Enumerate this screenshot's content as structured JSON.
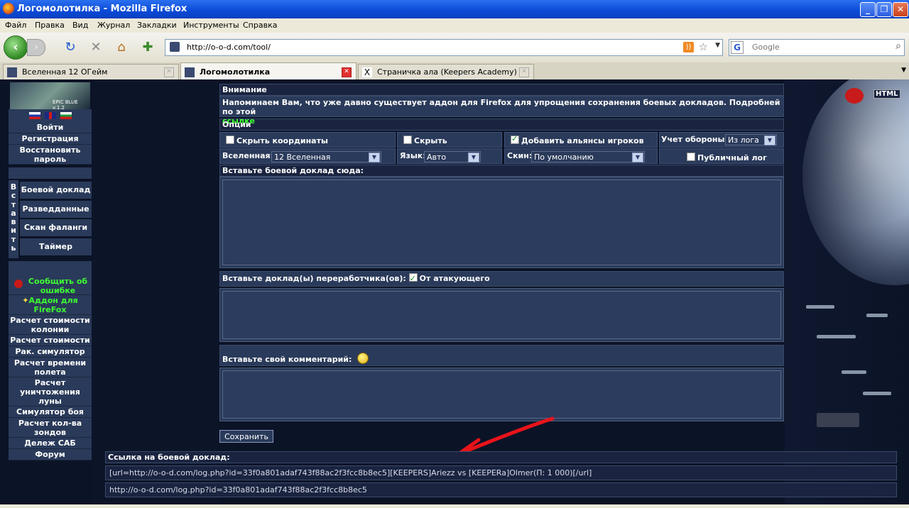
{
  "window": {
    "title": "Логомолотилка - Mozilla Firefox"
  },
  "menu": [
    "Файл",
    "Правка",
    "Вид",
    "Журнал",
    "Закладки",
    "Инструменты",
    "Справка"
  ],
  "nav": {
    "url": "http://o-o-d.com/tool/",
    "search_placeholder": "Google"
  },
  "tabs": [
    {
      "label": "Вселенная 12 ОГейм",
      "active": false
    },
    {
      "label": "Логомолотилка",
      "active": true
    },
    {
      "label": "Страничка ала (Keepers Academy)",
      "active": false
    }
  ],
  "sidebar": {
    "logo_text": "EPIC BLUE v.1.2",
    "top_items": [
      "Войти",
      "Регистрация",
      "Восстановить пароль"
    ],
    "insert_label": "Вставить",
    "insert_items": [
      "Боевой доклад",
      "Разведданные",
      "Скан фаланги",
      "Таймер"
    ],
    "report_bug": "Сообщить об ошибке",
    "addon": "Аддон для FireFox",
    "tools": [
      "Расчет стоимости колонии",
      "Расчет стоимости",
      "Рак. симулятор",
      "Расчет времени полета",
      "Расчет уничтожения луны",
      "Симулятор боя",
      "Расчет кол-ва зондов",
      "Дележ САБ",
      "Форум"
    ]
  },
  "main": {
    "attention_header": "Внимание",
    "attention_text": "Напоминаем Вам, что уже давно существует аддон для Firefox для упрощения сохранения боевых докладов. Подробней по этой",
    "attention_link": "ссылке",
    "options_header": "Опции",
    "opt_hide_coords": "Скрыть координаты",
    "opt_hide_tech": "Скрыть технологии",
    "opt_add_alliances": "Добавить альянсы игроков",
    "opt_defense_label": "Учет обороны:",
    "opt_defense_value": "Из лога",
    "universe_label": "Вселенная:",
    "universe_value": "12 Вселенная",
    "lang_label": "Язык:",
    "lang_value": "Авто",
    "skin_label": "Скин:",
    "skin_value": "По умолчанию",
    "public_log": "Публичный лог",
    "paste_report": "Вставьте боевой доклад сюда:",
    "paste_recycler": "Вставьте доклад(ы) переработчика(ов):",
    "from_attacker": "От атакующего",
    "paste_comment": "Вставьте свой комментарий:",
    "save_button": "Сохранить"
  },
  "link": {
    "header": "Ссылка на боевой доклад:",
    "bbcode": "[url=http://o-o-d.com/log.php?id=33f0a801adaf743f88ac2f3fcc8b8ec5][KEEPERS]Ariezz vs [KEEPERa]Olmer(П: 1 000)[/url]",
    "plain": "http://o-o-d.com/log.php?id=33f0a801adaf743f88ac2f3fcc8b8ec5"
  },
  "page_badge": "HTML",
  "colors": {
    "panel": "#2a3a5a",
    "header": "#1a2440",
    "link_green": "#3dff30",
    "arrow_red": "#e8141a"
  }
}
